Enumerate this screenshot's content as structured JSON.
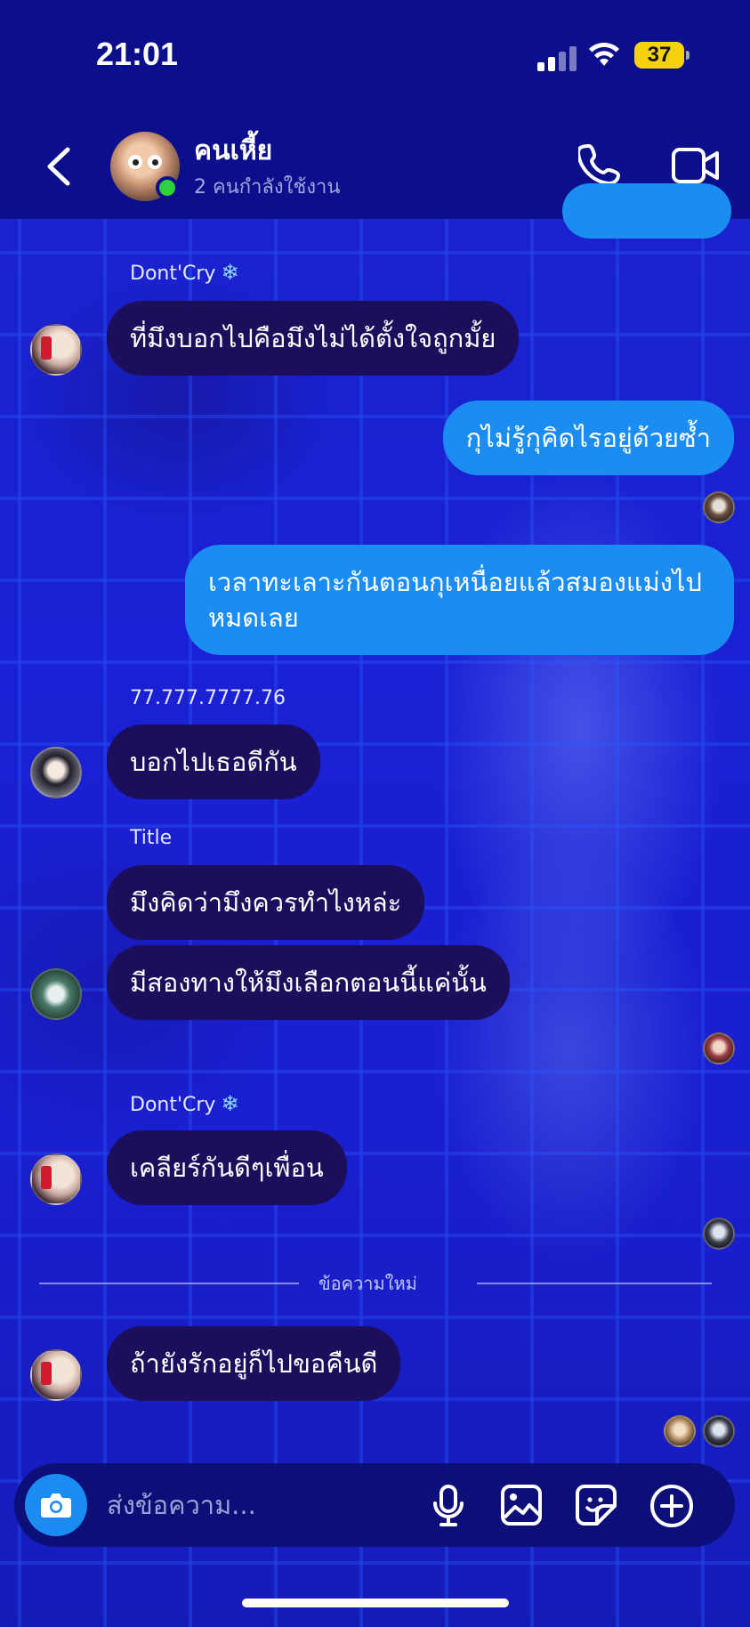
{
  "status_bar": {
    "time": "21:01",
    "battery": "37"
  },
  "header": {
    "title": "คนเหี้ย",
    "subtitle": "2 คนกำลังใช้งาน"
  },
  "messages": {
    "m1_sender": "Dont'Cry",
    "m1_text": "ที่มึงบอกไปคือมึงไม่ได้ตั้งใจถูกมั้ย",
    "m2_text": "กุไม่รู้กุคิดไรอยู่ด้วยซ้ำ",
    "m3_text": "เวลาทะเลาะกันตอนกุเหนื่อยแล้วสมองแม่งไปหมดเลย",
    "m4_sender": "77.777.7777.76",
    "m4_text": "บอกไปเธอดีกัน",
    "m5_sender": "Title",
    "m5_text": "มึงคิดว่ามึงควรทำไงหล่ะ",
    "m6_text": "มีสองทางให้มึงเลือกตอนนี้แค่นั้น",
    "m7_sender": "Dont'Cry",
    "m7_text": "เคลียร์กันดีๆเพื่อน",
    "new_messages_label": "ข้อความใหม่",
    "m8_text": "ถ้ายังรักอยู่ก็ไปขอคืนดี",
    "snow_glyph": "❄"
  },
  "composer": {
    "placeholder": "ส่งข้อความ..."
  },
  "colors": {
    "header_bg": "#0b0f8c",
    "incoming_bubble": "#1d0e5c",
    "outgoing_bubble": "#1a8cf2",
    "online": "#2fd13c"
  },
  "icons": [
    "back-icon",
    "phone-icon",
    "video-icon",
    "camera-icon",
    "microphone-icon",
    "image-icon",
    "sticker-icon",
    "plus-icon",
    "snowflake-icon"
  ]
}
